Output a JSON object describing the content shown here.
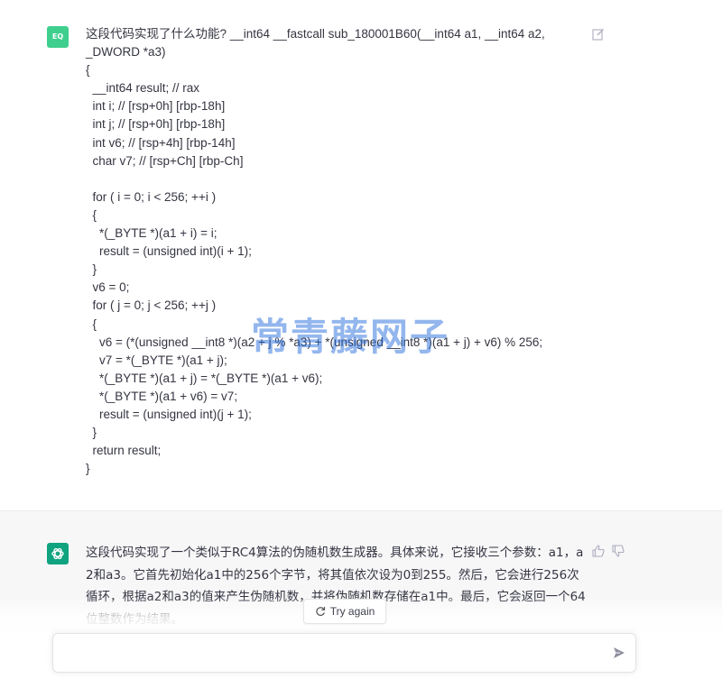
{
  "user_message": {
    "avatar": "EQ",
    "text": "这段代码实现了什么功能? __int64 __fastcall sub_180001B60(__int64 a1, __int64 a2,\n_DWORD *a3)\n{\n  __int64 result; // rax\n  int i; // [rsp+0h] [rbp-18h]\n  int j; // [rsp+0h] [rbp-18h]\n  int v6; // [rsp+4h] [rbp-14h]\n  char v7; // [rsp+Ch] [rbp-Ch]\n\n  for ( i = 0; i < 256; ++i )\n  {\n    *(_BYTE *)(a1 + i) = i;\n    result = (unsigned int)(i + 1);\n  }\n  v6 = 0;\n  for ( j = 0; j < 256; ++j )\n  {\n    v6 = (*(unsigned __int8 *)(a2 + j % *a3) + *(unsigned __int8 *)(a1 + j) + v6) % 256;\n    v7 = *(_BYTE *)(a1 + j);\n    *(_BYTE *)(a1 + j) = *(_BYTE *)(a1 + v6);\n    *(_BYTE *)(a1 + v6) = v7;\n    result = (unsigned int)(j + 1);\n  }\n  return result;\n}",
    "edit_icon": "edit-icon"
  },
  "assistant_message": {
    "text": "这段代码实现了一个类似于RC4算法的伪随机数生成器。具体来说，它接收三个参数：a1，a2和a3。它首先初始化a1中的256个字节，将其值依次设为0到255。然后，它会进行256次循环，根据a2和a3的值来产生伪随机数，并将伪随机数存储在a1中。最后，它会返回一个64位整数作为结果。",
    "icons": [
      "thumbs-up-icon",
      "thumbs-down-icon"
    ]
  },
  "controls": {
    "try_again_label": "Try again",
    "composer_placeholder": ""
  },
  "watermark": "常青藤网子",
  "colors": {
    "user_avatar": "#3ecf8e",
    "assistant_avatar": "#10a37f",
    "assistant_bg": "#f7f7f8",
    "watermark": "#286edc"
  }
}
